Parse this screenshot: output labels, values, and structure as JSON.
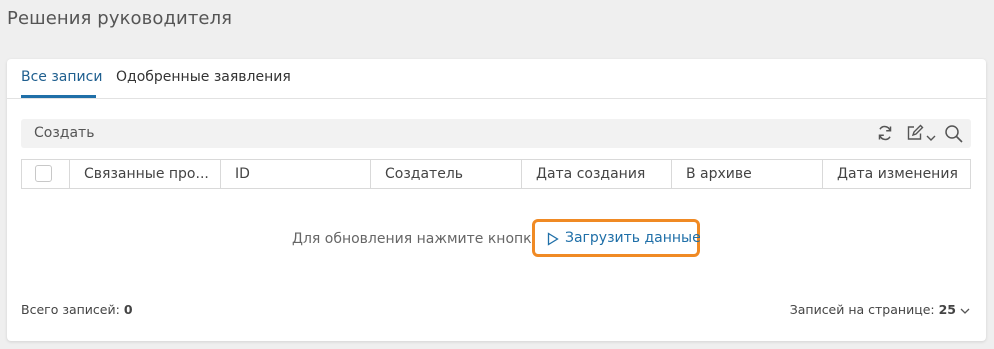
{
  "page": {
    "title": "Решения руководителя"
  },
  "tabs": [
    {
      "label": "Все записи",
      "active": true
    },
    {
      "label": "Одобренные заявления",
      "active": false
    }
  ],
  "toolbar": {
    "create_label": "Создать",
    "icons": [
      "refresh-icon",
      "edit-icon",
      "chevron-down-icon",
      "search-icon"
    ]
  },
  "grid": {
    "columns": [
      "Связанные про...",
      "ID",
      "Создатель",
      "Дата создания",
      "В архиве",
      "Дата изменения"
    ]
  },
  "empty_state": {
    "message": "Для обновления нажмите кнопку",
    "load_button_label": "Загрузить данные",
    "highlight_color": "#f08a24"
  },
  "footer": {
    "total_label": "Всего записей:",
    "total_value": "0",
    "per_page_label": "Записей на странице:",
    "per_page_value": "25"
  },
  "colors": {
    "accent": "#1f6fa8"
  }
}
